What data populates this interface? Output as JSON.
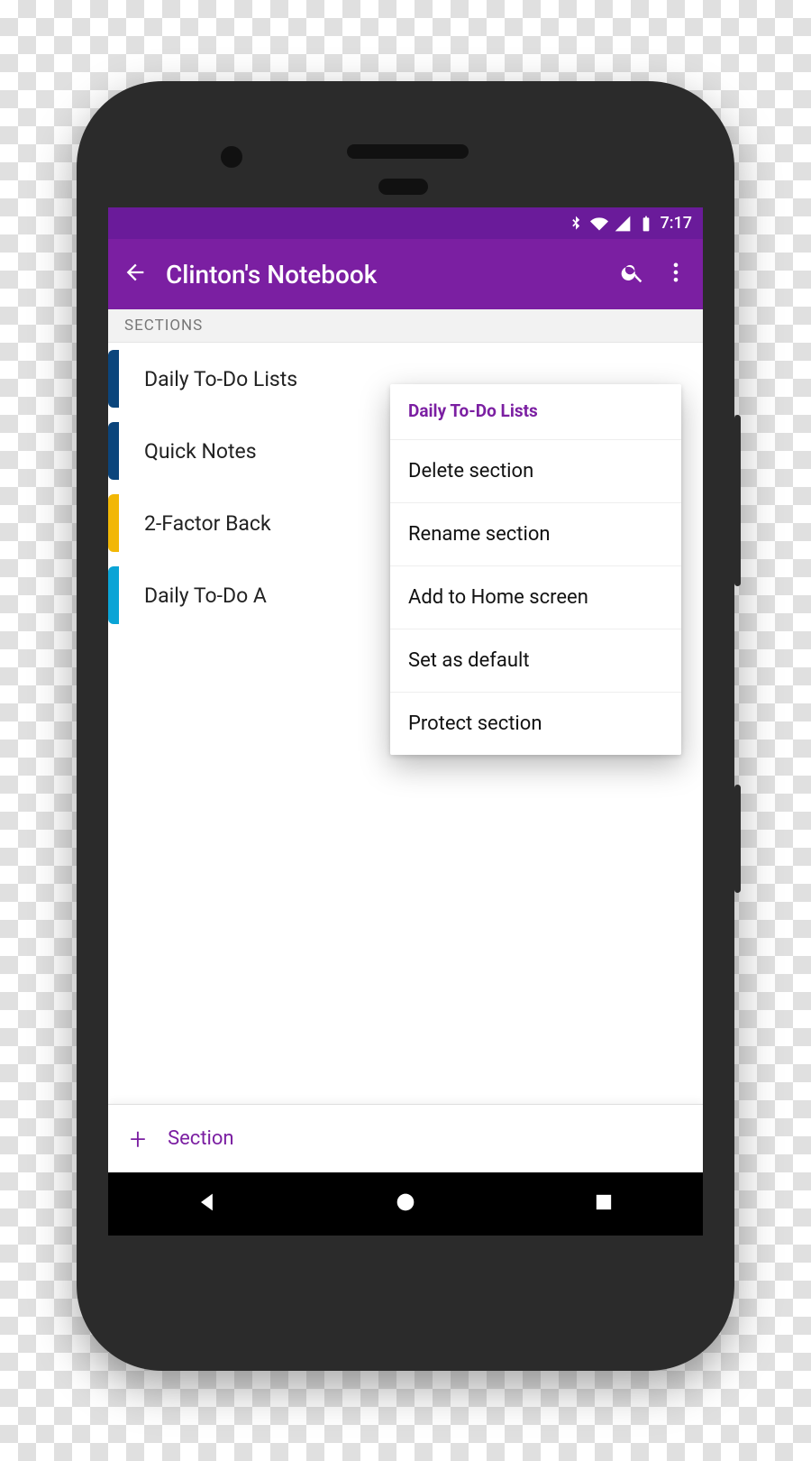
{
  "status": {
    "time": "7:17"
  },
  "appbar": {
    "title": "Clinton's Notebook"
  },
  "sections_header": "SECTIONS",
  "sections": [
    {
      "label": "Daily To-Do Lists",
      "color": "#0b457c"
    },
    {
      "label": "Quick Notes",
      "color": "#0b457c"
    },
    {
      "label": "2-Factor Back",
      "color": "#f2b705"
    },
    {
      "label": "Daily To-Do A",
      "color": "#0aa4d6"
    }
  ],
  "popup": {
    "title": "Daily To-Do Lists",
    "items": [
      "Delete section",
      "Rename section",
      "Add to Home screen",
      "Set as default",
      "Protect section"
    ]
  },
  "add_section": {
    "label": "Section"
  }
}
